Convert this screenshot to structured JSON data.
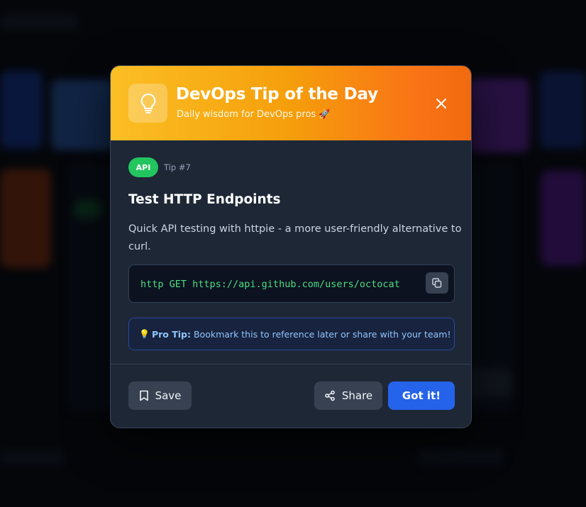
{
  "modal": {
    "title": "DevOps Tip of the Day",
    "subtitle": "Daily wisdom for DevOps pros 🚀",
    "icon": "lightbulb-icon",
    "close_icon": "close-icon"
  },
  "tip": {
    "category": "API",
    "number": "Tip #7",
    "title": "Test HTTP Endpoints",
    "description": "Quick API testing with httpie - a more user-friendly alternative to curl.",
    "code": "http GET https://api.github.com/users/octocat",
    "pro_tip_emoji": "💡",
    "pro_tip_label": "Pro Tip:",
    "pro_tip_text": "Bookmark this to reference later or share with your team!"
  },
  "actions": {
    "save_label": "Save",
    "share_label": "Share",
    "got_it_label": "Got it!"
  },
  "colors": {
    "header_gradient_start": "#fbbf24",
    "header_gradient_end": "#f26a0f",
    "badge": "#22c55e",
    "code_text": "#4ade80",
    "primary_button": "#2563eb",
    "pro_tip_text": "#93c5fd"
  }
}
